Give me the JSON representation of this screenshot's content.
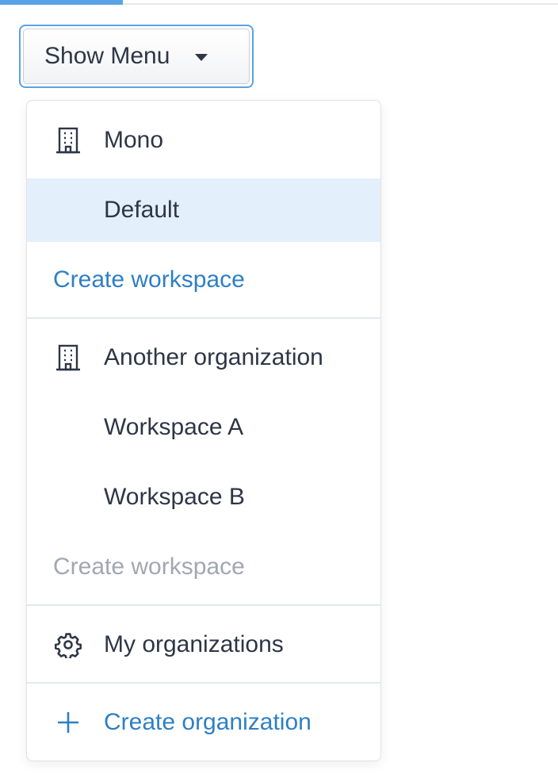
{
  "toggle": {
    "label": "Show Menu",
    "caret_icon": "caret-down-icon"
  },
  "progress": {
    "color": "#5aa3e6",
    "fraction": 0.22
  },
  "menu": {
    "org1": {
      "name": "Mono",
      "icon": "building-icon",
      "workspaces": [
        "Default"
      ],
      "selected_workspace": "Default",
      "create_label": "Create workspace"
    },
    "org2": {
      "name": "Another organization",
      "icon": "building-icon",
      "workspaces": [
        "Workspace A",
        "Workspace B"
      ],
      "create_label": "Create workspace",
      "create_disabled": true
    },
    "my_orgs": {
      "label": "My organizations",
      "icon": "gear-icon"
    },
    "create_org": {
      "label": "Create organization",
      "icon": "plus-icon"
    }
  },
  "colors": {
    "accent": "#2e7fc4",
    "selected_bg": "#e3f0fb",
    "text": "#2e3646",
    "disabled": "#a1a7b2"
  }
}
